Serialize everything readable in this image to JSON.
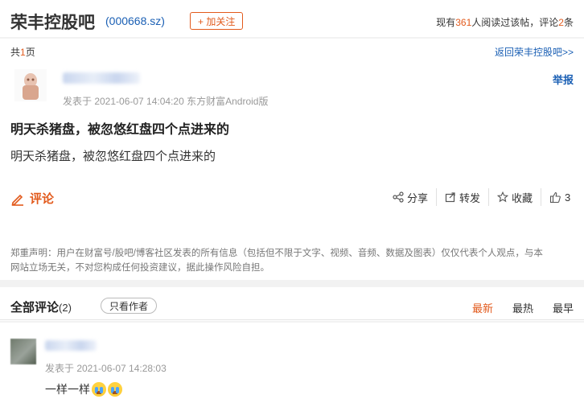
{
  "header": {
    "title": "荣丰控股吧",
    "code": "(000668.sz)",
    "follow_label": "+ 加关注",
    "stats_prefix": "现有",
    "reader_count": "361",
    "stats_middle": "人阅读过该帖，评论",
    "comment_count": "2",
    "stats_suffix": "条"
  },
  "pager": {
    "prefix": "共",
    "pages": "1",
    "suffix": "页",
    "back_link": "返回荣丰控股吧>>"
  },
  "post": {
    "report_label": "举报",
    "meta": "发表于 2021-06-07 14:04:20 东方财富Android版",
    "title": "明天杀猪盘，被忽悠红盘四个点进来的",
    "body": "明天杀猪盘，被忽悠红盘四个点进来的",
    "comment_label": "评论",
    "actions": {
      "share": "分享",
      "repost": "转发",
      "favorite": "收藏",
      "like_count": "3"
    },
    "disclaimer_line1": "郑重声明：用户在财富号/股吧/博客社区发表的所有信息（包括但不限于文字、视频、音频、数据及图表）仅仅代表个人观点，与本",
    "disclaimer_line2": "网站立场无关，不对您构成任何投资建议，据此操作风险自担。"
  },
  "comments_section": {
    "title": "全部评论",
    "count": "(2)",
    "filter_label": "只看作者",
    "sort_tabs": [
      "最新",
      "最热",
      "最早"
    ],
    "active_tab": "最新"
  },
  "comment": {
    "meta": "发表于 2021-06-07 14:28:03",
    "text": "一样一样",
    "emoji_names": [
      "crying-face-emoji",
      "crying-face-emoji"
    ]
  },
  "colors": {
    "accent": "#e25a1c",
    "link": "#1a5fb4",
    "background": "#f2f2f2"
  }
}
